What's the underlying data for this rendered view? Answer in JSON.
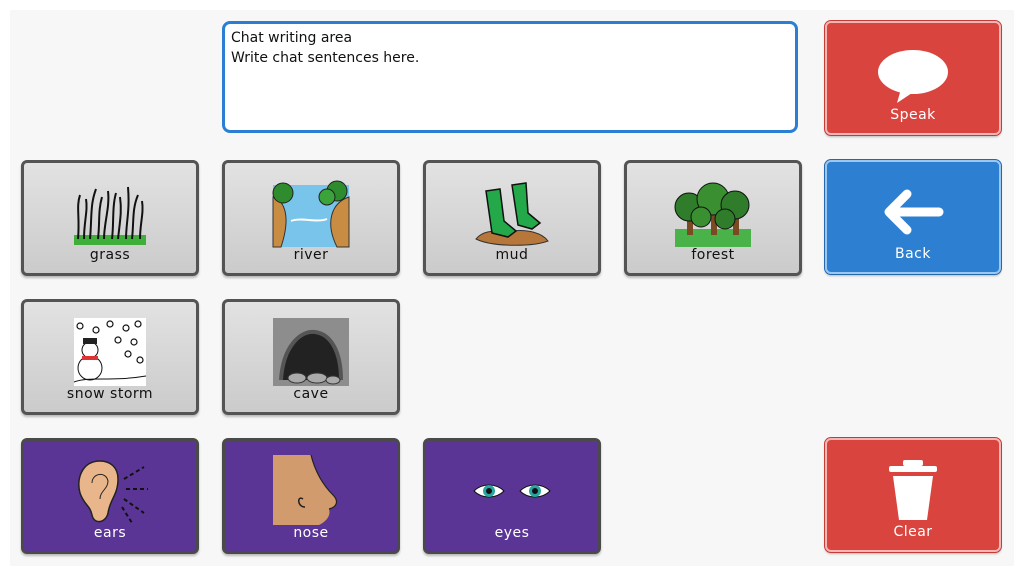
{
  "chat": {
    "line1": "Chat writing area",
    "line2": "Write chat sentences here."
  },
  "actions": {
    "speak": "Speak",
    "back": "Back",
    "clear": "Clear"
  },
  "tiles": {
    "grass": "grass",
    "river": "river",
    "mud": "mud",
    "forest": "forest",
    "snow_storm": "snow storm",
    "cave": "cave",
    "ears": "ears",
    "nose": "nose",
    "eyes": "eyes"
  },
  "colors": {
    "accent_blue": "#2d7fd1",
    "action_red": "#d9443f",
    "body_purple": "#5b3596",
    "tile_grey": "#d6d6d6"
  }
}
